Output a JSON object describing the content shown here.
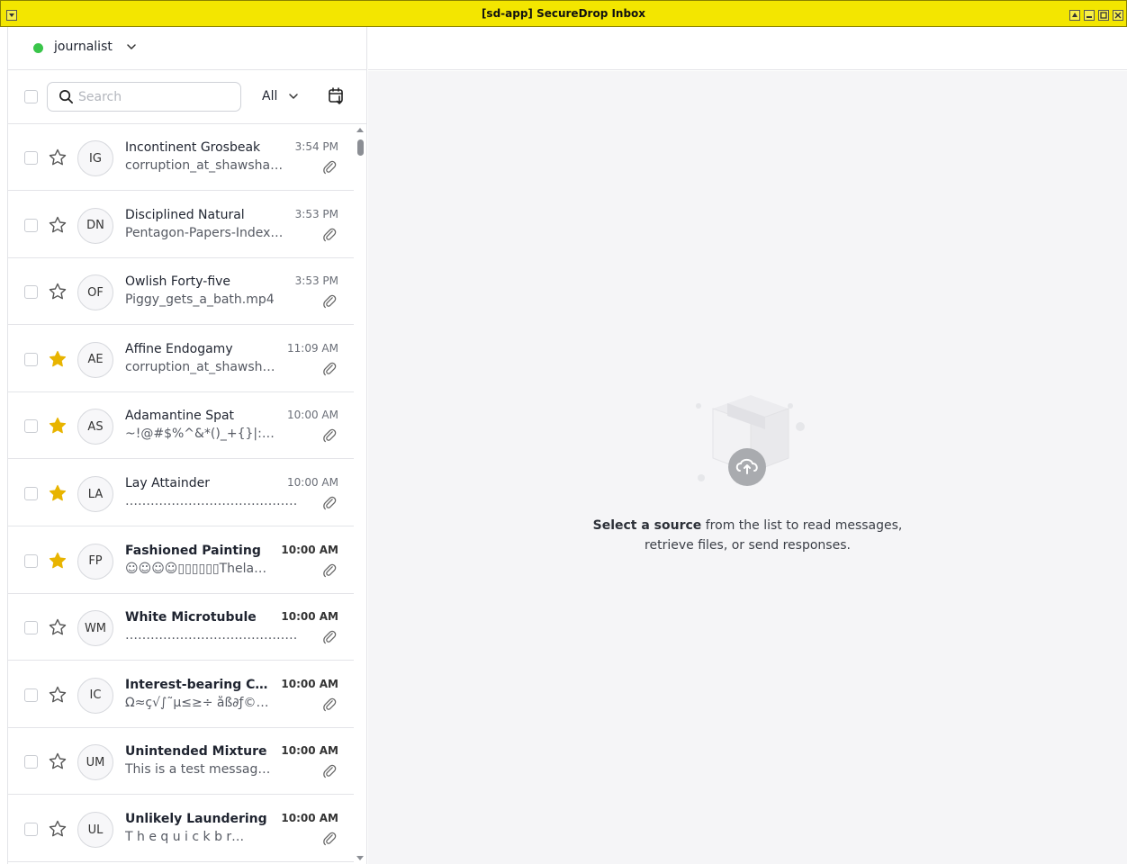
{
  "window": {
    "title": "[sd-app] SecureDrop Inbox"
  },
  "user": {
    "name": "journalist",
    "status_color": "#39c54a"
  },
  "search": {
    "placeholder": "Search",
    "filter_label": "All"
  },
  "colors": {
    "star_active": "#e8b400",
    "titlebar": "#f3e600"
  },
  "sources": [
    {
      "initials": "IG",
      "name": "Incontinent Grosbeak",
      "time": "3:54 PM",
      "preview": "corruption_at_shawsha…",
      "starred": false,
      "unread": false
    },
    {
      "initials": "DN",
      "name": "Disciplined Natural",
      "time": "3:53 PM",
      "preview": "Pentagon-Papers-Index…",
      "starred": false,
      "unread": false
    },
    {
      "initials": "OF",
      "name": "Owlish Forty-five",
      "time": "3:53 PM",
      "preview": "Piggy_gets_a_bath.mp4",
      "starred": false,
      "unread": false
    },
    {
      "initials": "AE",
      "name": "Affine Endogamy",
      "time": "11:09 AM",
      "preview": "corruption_at_shawsh…",
      "starred": true,
      "unread": false
    },
    {
      "initials": "AS",
      "name": "Adamantine Spat",
      "time": "10:00 AM",
      "preview": "~!@#$%^&*()_+{}|:…",
      "starred": true,
      "unread": false
    },
    {
      "initials": "LA",
      "name": "Lay Attainder",
      "time": "10:00 AM",
      "preview": "……………………………………",
      "starred": true,
      "unread": false
    },
    {
      "initials": "FP",
      "name": "Fashioned Painting",
      "time": "10:00 AM",
      "preview": "☺☺☺☺▯▯▯▯▯▯Thela…",
      "starred": true,
      "unread": true
    },
    {
      "initials": "WM",
      "name": "White Microtubule",
      "time": "10:00 AM",
      "preview": "……………………………………",
      "starred": false,
      "unread": true
    },
    {
      "initials": "IC",
      "name": "Interest-bearing C…",
      "time": "10:00 AM",
      "preview": "Ω≈ç√∫˜µ≤≥÷ åß∂ƒ©…",
      "starred": false,
      "unread": true
    },
    {
      "initials": "UM",
      "name": "Unintended Mixture",
      "time": "10:00 AM",
      "preview": "This is a test messag…",
      "starred": false,
      "unread": true
    },
    {
      "initials": "UL",
      "name": "Unlikely Laundering",
      "time": "10:00 AM",
      "preview": "T h e  q u i c k  b r…",
      "starred": false,
      "unread": true
    }
  ],
  "empty_state": {
    "bold": "Select a source",
    "line1_rest": " from the list to read messages,",
    "line2": "retrieve files, or send responses."
  }
}
